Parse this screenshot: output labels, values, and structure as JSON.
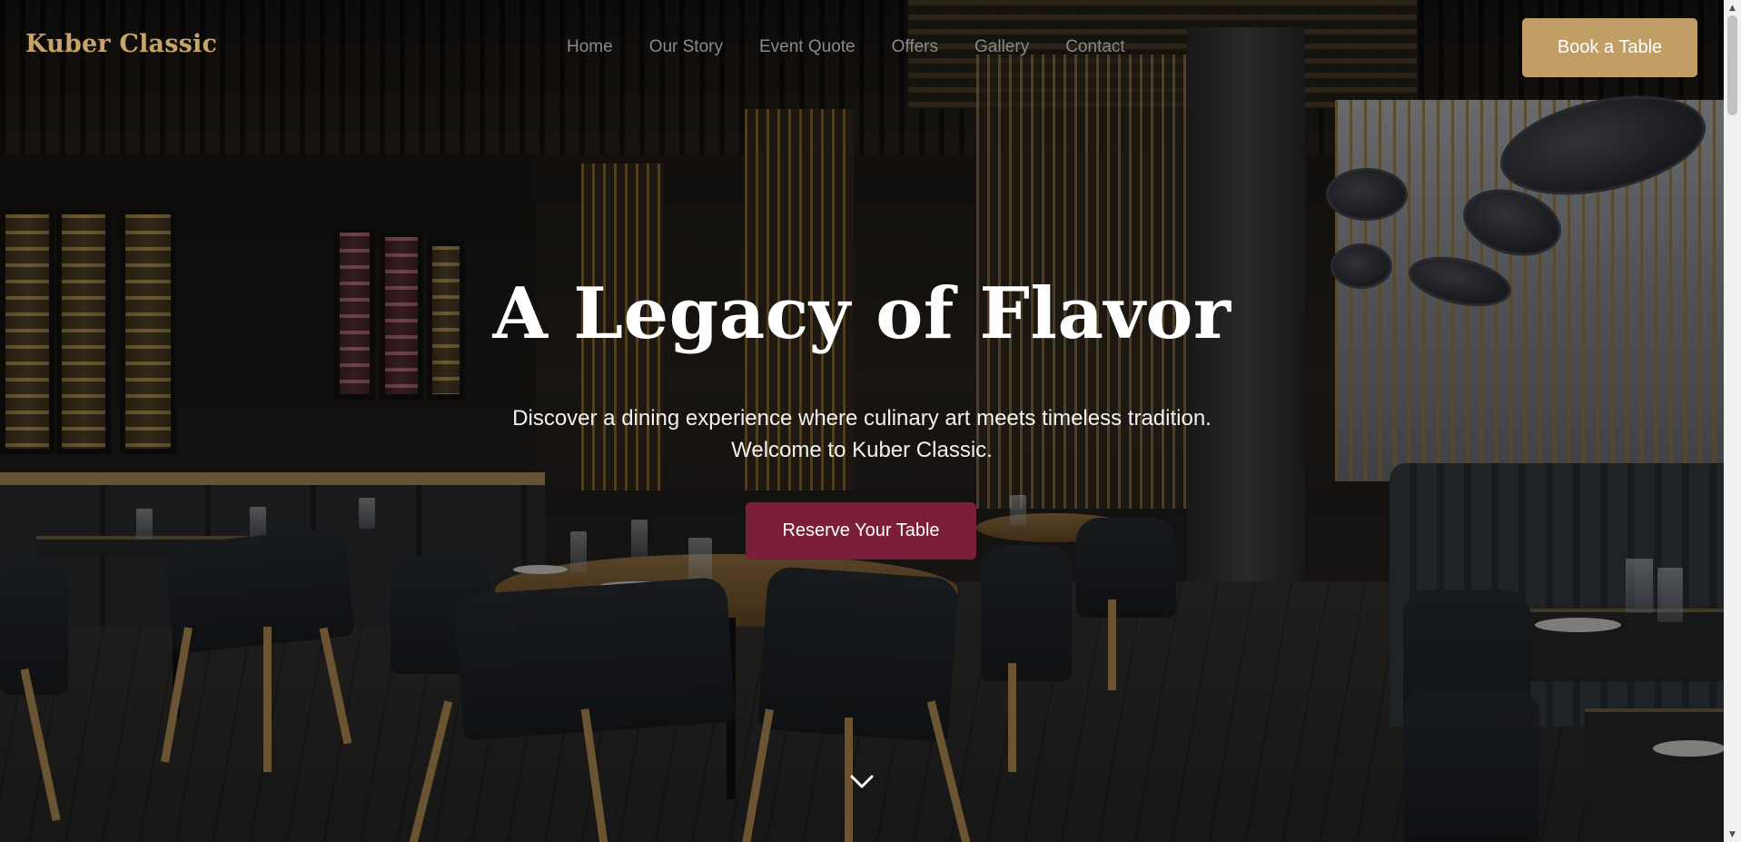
{
  "brand": {
    "name": "Kuber Classic",
    "color": "#c8a468"
  },
  "nav": {
    "items": [
      {
        "label": "Home"
      },
      {
        "label": "Our Story"
      },
      {
        "label": "Event Quote"
      },
      {
        "label": "Offers"
      },
      {
        "label": "Gallery"
      },
      {
        "label": "Contact"
      }
    ]
  },
  "header": {
    "cta_label": "Book a Table",
    "cta_color": "#c19e66"
  },
  "hero": {
    "title": "A Legacy of Flavor",
    "subtitle_line1": "Discover a dining experience where culinary art meets timeless tradition.",
    "subtitle_line2": "Welcome to Kuber Classic.",
    "cta_label": "Reserve Your Table",
    "cta_color": "#7b1e3a",
    "scroll_icon": "chevron-down-icon"
  },
  "scrollbar": {
    "up_icon": "▲",
    "down_icon": "▼"
  }
}
